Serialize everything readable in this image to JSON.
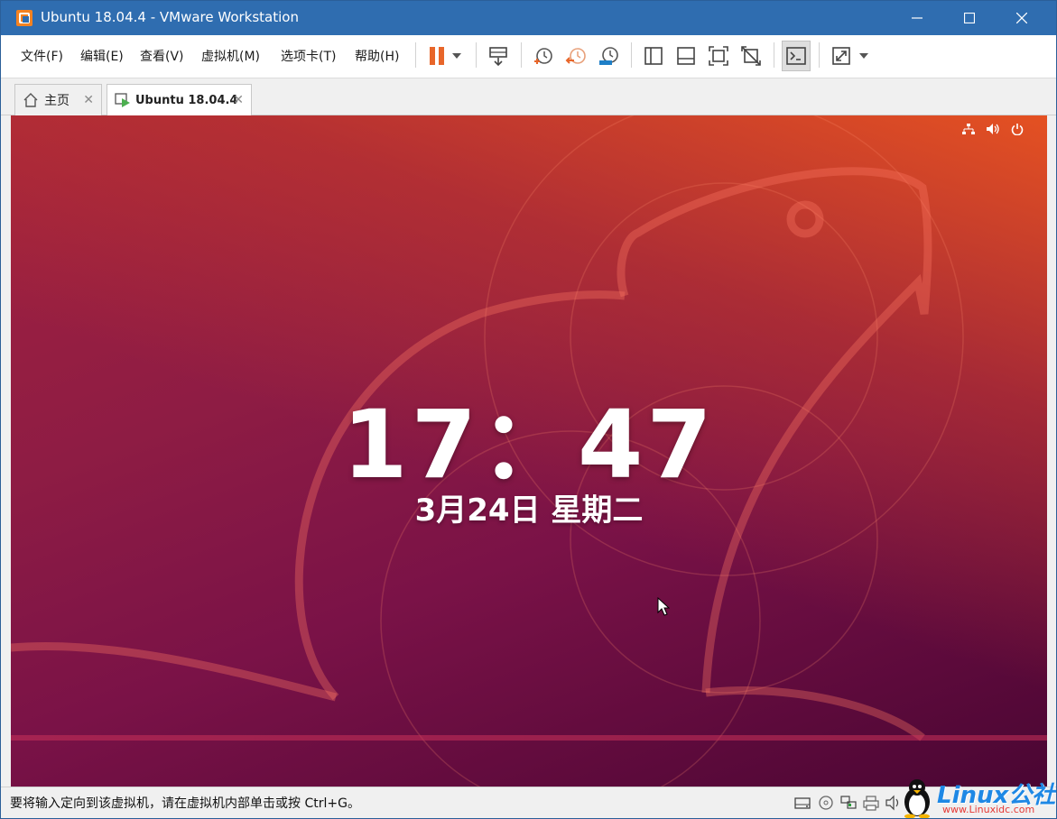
{
  "window": {
    "title": "Ubuntu 18.04.4 - VMware Workstation",
    "accent": "#2f6db0"
  },
  "menu": {
    "items": [
      "文件(F)",
      "编辑(E)",
      "查看(V)",
      "虚拟机(M)",
      "选项卡(T)",
      "帮助(H)"
    ]
  },
  "toolbar": {
    "icons": [
      "pause-icon",
      "dropdown-icon",
      "send-ctrl-alt-del-icon",
      "snapshot-take-icon",
      "snapshot-revert-icon",
      "snapshot-manager-icon",
      "show-library-icon",
      "thumbnail-bar-icon",
      "fit-guest-icon",
      "fullscreen-exit-icon",
      "console-view-icon",
      "fullscreen-icon",
      "dropdown-icon"
    ],
    "pause_color": "#e8662a"
  },
  "tabs": [
    {
      "label": "主页",
      "icon": "home-icon",
      "active": false
    },
    {
      "label": "Ubuntu 18.04.4",
      "icon": "vm-running-icon",
      "active": true
    }
  ],
  "vm": {
    "time": "17：47",
    "date": "3月24日 星期二",
    "status_icons": [
      "network-icon",
      "volume-icon",
      "power-icon"
    ]
  },
  "statusbar": {
    "message": "要将输入定向到该虚拟机，请在虚拟机内部单击或按 Ctrl+G。",
    "icons": [
      "hard-disk-icon",
      "cd-dvd-icon",
      "network-adapter-icon",
      "printer-icon",
      "sound-card-icon"
    ]
  },
  "watermark": {
    "text": "Linux公社",
    "url": "www.Linuxidc.com"
  }
}
